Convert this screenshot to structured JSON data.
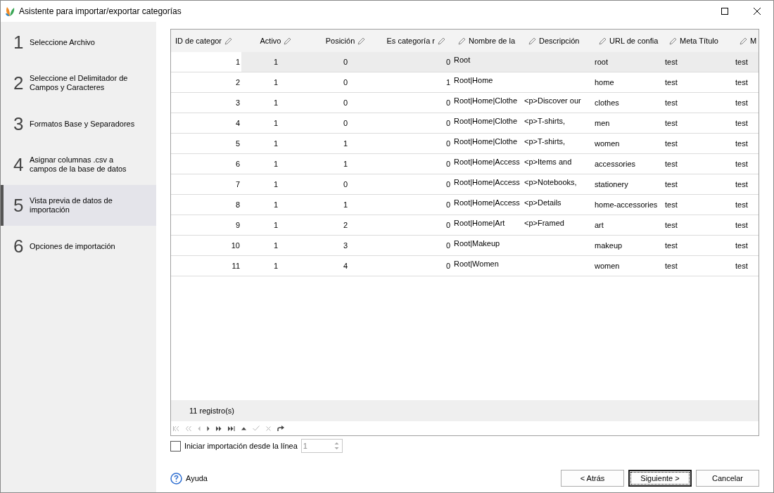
{
  "window": {
    "title": "Asistente para importar/exportar categorías"
  },
  "steps": [
    {
      "number": "1",
      "label": "Seleccione Archivo",
      "selected": false
    },
    {
      "number": "2",
      "label": "Seleccione el Delimitador de Campos y Caracteres",
      "selected": false
    },
    {
      "number": "3",
      "label": "Formatos Base y Separadores",
      "selected": false
    },
    {
      "number": "4",
      "label": "Asignar columnas .csv a campos de la base de datos",
      "selected": false
    },
    {
      "number": "5",
      "label": "Vista previa de datos de importación",
      "selected": true
    },
    {
      "number": "6",
      "label": "Opciones de importación",
      "selected": false
    }
  ],
  "table": {
    "columns": [
      {
        "label": "ID de categor"
      },
      {
        "label": "Activo"
      },
      {
        "label": "Posición"
      },
      {
        "label": "Es categoría r"
      },
      {
        "label": "Nombre de la"
      },
      {
        "label": "Descripción"
      },
      {
        "label": "URL de confia"
      },
      {
        "label": "Meta Título"
      },
      {
        "label": "M"
      }
    ],
    "rows": [
      {
        "selected": true,
        "cells": [
          "1",
          "1",
          "0",
          "0",
          "Root",
          "",
          "root",
          "test",
          "test"
        ]
      },
      {
        "selected": false,
        "cells": [
          "2",
          "1",
          "0",
          "1",
          "Root|Home",
          "",
          "home",
          "test",
          "test"
        ]
      },
      {
        "selected": false,
        "cells": [
          "3",
          "1",
          "0",
          "0",
          "Root|Home|Clothe",
          "<p>Discover our",
          "clothes",
          "test",
          "test"
        ]
      },
      {
        "selected": false,
        "cells": [
          "4",
          "1",
          "0",
          "0",
          "Root|Home|Clothe",
          "<p>T-shirts,",
          "men",
          "test",
          "test"
        ]
      },
      {
        "selected": false,
        "cells": [
          "5",
          "1",
          "1",
          "0",
          "Root|Home|Clothe",
          "<p>T-shirts,",
          "women",
          "test",
          "test"
        ]
      },
      {
        "selected": false,
        "cells": [
          "6",
          "1",
          "1",
          "0",
          "Root|Home|Access",
          "<p>Items and",
          "accessories",
          "test",
          "test"
        ]
      },
      {
        "selected": false,
        "cells": [
          "7",
          "1",
          "0",
          "0",
          "Root|Home|Access",
          "<p>Notebooks,",
          "stationery",
          "test",
          "test"
        ]
      },
      {
        "selected": false,
        "cells": [
          "8",
          "1",
          "1",
          "0",
          "Root|Home|Access",
          "<p>Details",
          "home-accessories",
          "test",
          "test"
        ]
      },
      {
        "selected": false,
        "cells": [
          "9",
          "1",
          "2",
          "0",
          "Root|Home|Art",
          "<p>Framed",
          "art",
          "test",
          "test"
        ]
      },
      {
        "selected": false,
        "cells": [
          "10",
          "1",
          "3",
          "0",
          "Root|Makeup",
          "",
          "makeup",
          "test",
          "test"
        ]
      },
      {
        "selected": false,
        "cells": [
          "11",
          "1",
          "4",
          "0",
          "Root|Women",
          "",
          "women",
          "test",
          "test"
        ]
      }
    ],
    "footer": "11 registro(s)"
  },
  "start_line": {
    "label": "Iniciar importación desde la línea",
    "checked": false,
    "value": "1"
  },
  "help": "Ayuda",
  "buttons": [
    {
      "label": "< Atrás",
      "focused": false
    },
    {
      "label": "Siguiente >",
      "focused": true
    },
    {
      "label": "Cancelar",
      "focused": false
    }
  ]
}
